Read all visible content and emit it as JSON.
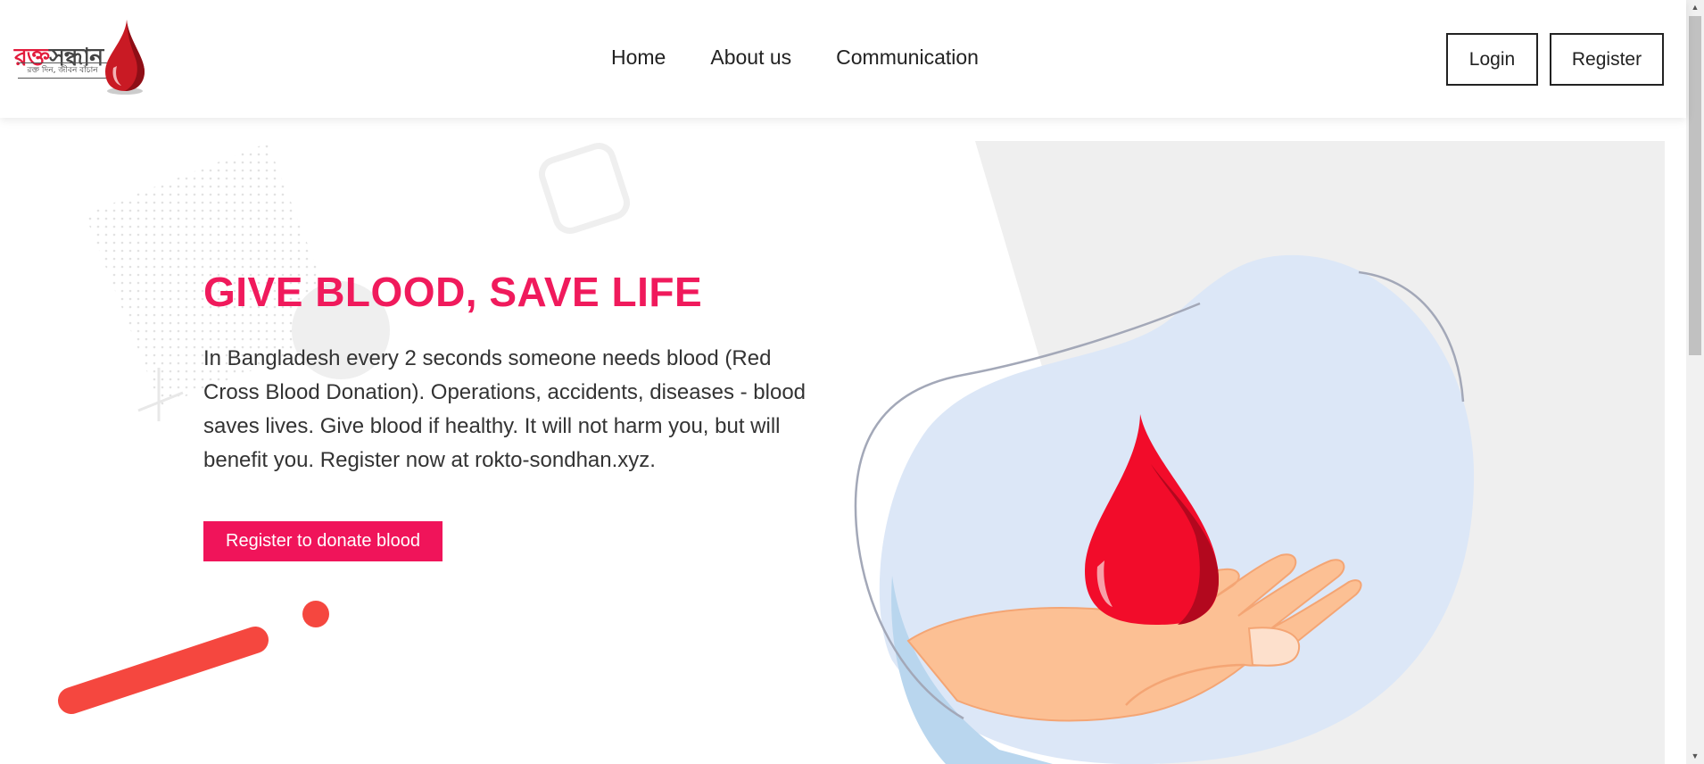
{
  "header": {
    "logo": {
      "title_red": "রক্ত",
      "title_dark": "সন্ধান",
      "tagline": "রক্ত দিন, জীবন বাঁচান"
    },
    "nav": [
      {
        "label": "Home"
      },
      {
        "label": "About us"
      },
      {
        "label": "Communication"
      }
    ],
    "login_label": "Login",
    "register_label": "Register"
  },
  "hero": {
    "headline": "GIVE BLOOD, SAVE LIFE",
    "paragraph": "In Bangladesh every 2 seconds someone needs blood (Red Cross Blood Donation). Operations, accidents, diseases - blood saves lives. Give blood if healthy. It will not harm you, but will benefit you. Register now at rokto-sondhan.xyz.",
    "cta_label": "Register to donate blood"
  },
  "colors": {
    "accent": "#f0145a",
    "blood": "#f20c2a",
    "blob": "#dce7f7",
    "panel": "#efefef",
    "decor_red": "#f5473f"
  }
}
